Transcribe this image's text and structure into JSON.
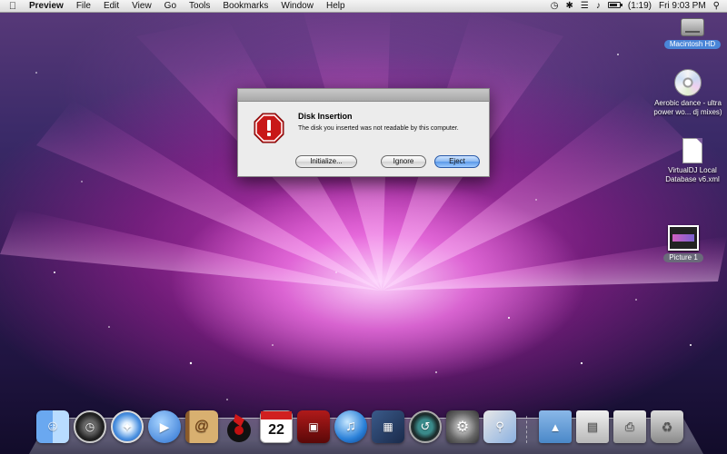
{
  "menubar": {
    "app_name": "Preview",
    "items": [
      "File",
      "Edit",
      "View",
      "Go",
      "Tools",
      "Bookmarks",
      "Window",
      "Help"
    ],
    "battery_text": "(1:19)",
    "clock": "Fri 9:03 PM"
  },
  "desktop_icons": {
    "hd_label": "Macintosh HD",
    "cd_label_line1": "Aerobic dance - ultra",
    "cd_label_line2": "power wo... dj mixes)",
    "db_label_line1": "VirtualDJ Local",
    "db_label_line2": "Database v6.xml",
    "picture_label": "Picture 1"
  },
  "dialog": {
    "title": "Disk Insertion",
    "message": "The disk you inserted was not readable by this computer.",
    "initialize_label": "Initialize...",
    "ignore_label": "Ignore",
    "eject_label": "Eject"
  },
  "dock": {
    "ical_date": "22",
    "ical_month": "JUL"
  }
}
